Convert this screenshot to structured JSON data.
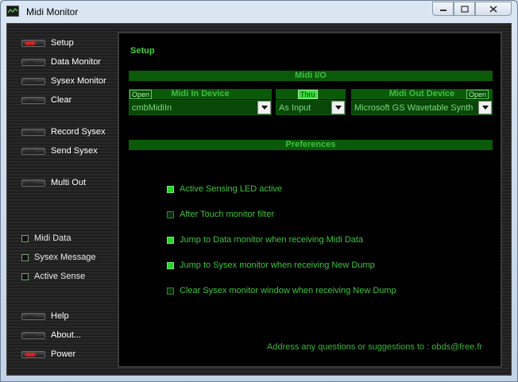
{
  "window": {
    "title": "Midi Monitor"
  },
  "sidebar": {
    "buttons": [
      {
        "label": "Setup",
        "active": true
      },
      {
        "label": "Data Monitor",
        "active": false
      },
      {
        "label": "Sysex Monitor",
        "active": false
      },
      {
        "label": "Clear",
        "active": false
      },
      {
        "label": "Record Sysex",
        "active": false
      },
      {
        "label": "Send Sysex",
        "active": false
      },
      {
        "label": "Multi Out",
        "active": false
      }
    ],
    "indicators": [
      {
        "label": "Midi Data"
      },
      {
        "label": "Sysex Message"
      },
      {
        "label": "Active Sense"
      }
    ],
    "bottom_buttons": [
      {
        "label": "Help",
        "active": false
      },
      {
        "label": "About...",
        "active": false
      },
      {
        "label": "Power",
        "active": true
      }
    ]
  },
  "setup": {
    "title": "Setup",
    "midi_io": {
      "header": "Midi I/O",
      "in_device": {
        "label": "Midi In Device",
        "open_label": "Open",
        "value": "cmbMidiIn"
      },
      "thru": {
        "label": "Thru",
        "value": "As Input"
      },
      "out_device": {
        "label": "Midi Out Device",
        "open_label": "Open",
        "value": "Microsoft GS Wavetable Synth"
      }
    },
    "preferences": {
      "header": "Preferences",
      "items": [
        {
          "label": "Active Sensing LED active",
          "checked": true
        },
        {
          "label": "After Touch monitor filter",
          "checked": false
        },
        {
          "label": "Jump to Data monitor when receiving Midi Data",
          "checked": true
        },
        {
          "label": "Jump to Sysex monitor when receiving New Dump",
          "checked": true
        },
        {
          "label": "Clear Sysex monitor window when receiving New Dump",
          "checked": false
        }
      ]
    },
    "footer": "Address any questions or suggestions to :  obds@free.fr"
  },
  "colors": {
    "accent_green": "#3fc43f",
    "led_red": "#e02020",
    "header_green": "#0b6b0b"
  }
}
